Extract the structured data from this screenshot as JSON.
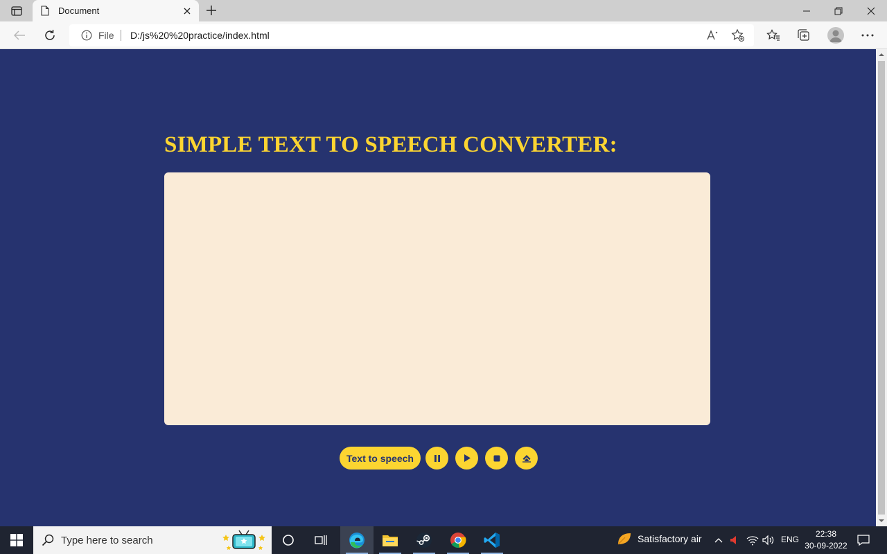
{
  "browser": {
    "tab_title": "Document",
    "address": {
      "scheme_label": "File",
      "url": "D:/js%20%20practice/index.html"
    }
  },
  "page": {
    "heading": "SIMPLE TEXT TO SPEECH CONVERTER:",
    "textarea": {
      "value": "",
      "placeholder": ""
    },
    "controls": {
      "speak_label": "Text to speech",
      "icons": [
        "pause-icon",
        "play-icon",
        "stop-icon",
        "eraser-icon"
      ]
    }
  },
  "colors": {
    "page_background": "#26336f",
    "accent_yellow": "#fcd531",
    "textarea_background": "#faebd7"
  },
  "taskbar": {
    "search_placeholder": "Type here to search",
    "pinned_apps": [
      "cortana",
      "task-view",
      "edge",
      "file-explorer",
      "steam",
      "chrome",
      "vscode"
    ],
    "weather": "Satisfactory air",
    "language": "ENG",
    "time": "22:38",
    "date": "30-09-2022"
  }
}
